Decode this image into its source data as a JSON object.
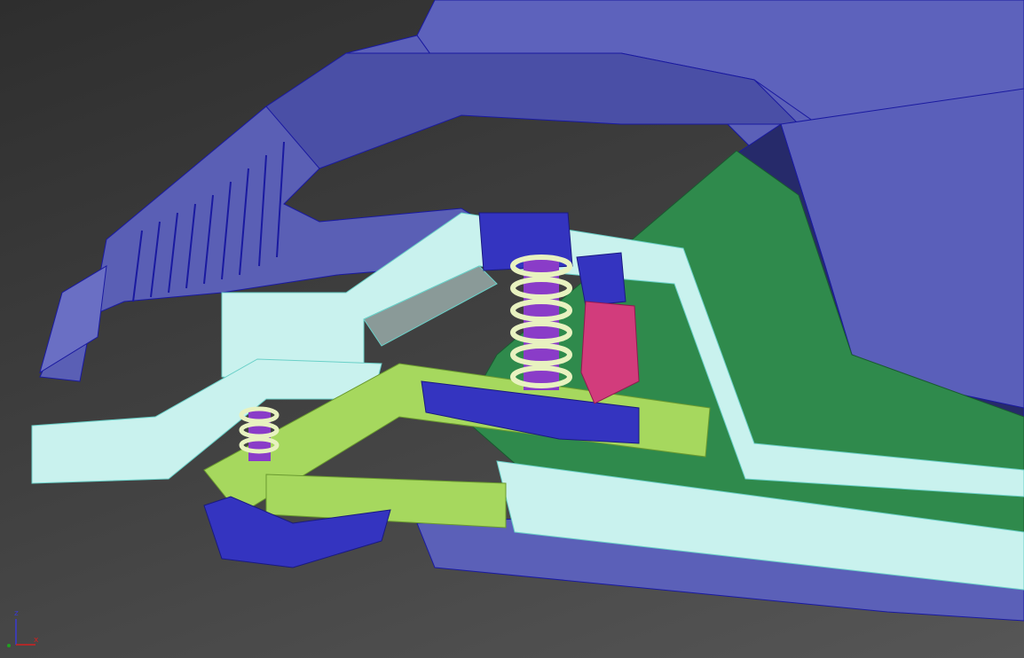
{
  "viewport": {
    "type": "3d-perspective-viewport",
    "colors": {
      "body": "#5b60b8",
      "body_edge": "#1a1aa0",
      "floor": "#2f8a4c",
      "frame": "#c9f2ee",
      "arm": "#a6d85e",
      "bracket": "#d23c7c",
      "spring_core": "#8a3cc8",
      "spring_coil": "#e8f2c0",
      "mount": "#3434c0"
    }
  },
  "axis_gizmo": {
    "z_label": "z",
    "x_label": "x",
    "z_color": "#3a3ad0",
    "x_color": "#d02020",
    "y_color": "#20a020"
  }
}
